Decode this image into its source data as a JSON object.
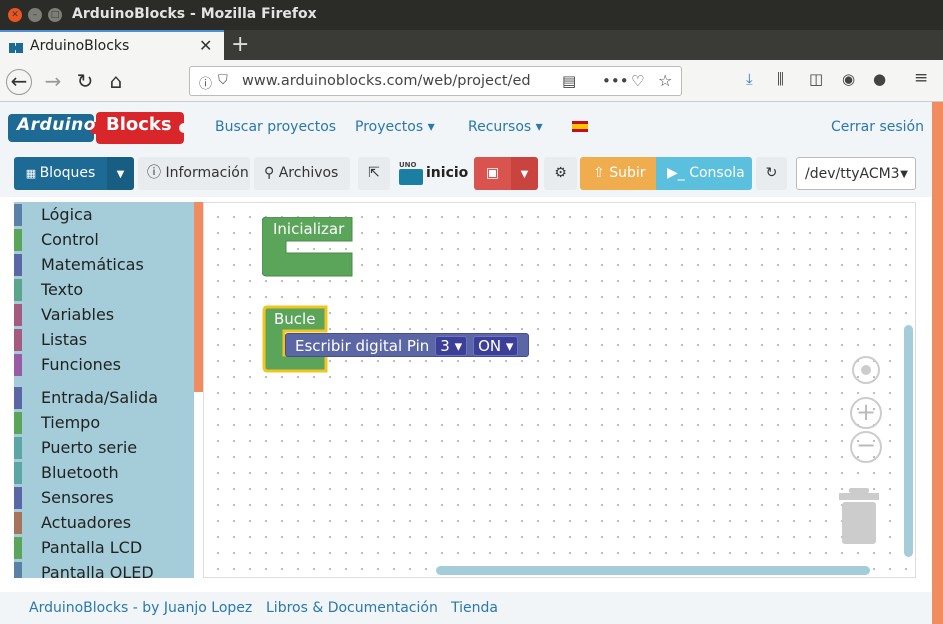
{
  "window": {
    "title": "ArduinoBlocks - Mozilla Firefox"
  },
  "browser": {
    "tab_title": "ArduinoBlocks",
    "url": "www.arduinoblocks.com/web/project/ed"
  },
  "header": {
    "logo_left": "Arduino",
    "logo_right": "Blocks",
    "nav": [
      "Buscar proyectos",
      "Proyectos ▾",
      "Recursos ▾"
    ],
    "logout": "Cerrar sesión"
  },
  "toolbar": {
    "bloques": "Bloques",
    "informacion": "Información",
    "archivos": "Archivos",
    "board_label": "UNO",
    "project_name": "inicio",
    "subir": "Subir",
    "consola": "Consola",
    "port": "/dev/ttyACM3"
  },
  "sidebar": {
    "categories": [
      {
        "label": "Lógica",
        "color": "#5b80a5"
      },
      {
        "label": "Control",
        "color": "#5ba55b"
      },
      {
        "label": "Matemáticas",
        "color": "#5b67a5"
      },
      {
        "label": "Texto",
        "color": "#5ba58c"
      },
      {
        "label": "Variables",
        "color": "#a55b80"
      },
      {
        "label": "Listas",
        "color": "#a55b80"
      },
      {
        "label": "Funciones",
        "color": "#995ba5"
      },
      {
        "label": "Entrada/Salida",
        "color": "#5b67a5"
      },
      {
        "label": "Tiempo",
        "color": "#5ba55b"
      },
      {
        "label": "Puerto serie",
        "color": "#5ba5a5"
      },
      {
        "label": "Bluetooth",
        "color": "#5ba5a5"
      },
      {
        "label": "Sensores",
        "color": "#5b67a5"
      },
      {
        "label": "Actuadores",
        "color": "#a5745b"
      },
      {
        "label": "Pantalla LCD",
        "color": "#5ba55b"
      },
      {
        "label": "Pantalla OLED",
        "color": "#5b80a5"
      }
    ]
  },
  "workspace": {
    "init_block": "Inicializar",
    "loop_block": "Bucle",
    "write_block": {
      "label": "Escribir digital Pin",
      "pin": "3 ▾",
      "state": "ON ▾"
    }
  },
  "footer": {
    "links": [
      "ArduinoBlocks - by Juanjo Lopez",
      "Libros & Documentación",
      "Tienda"
    ]
  },
  "colors": {
    "primary": "#1d6b95",
    "save": "#d9534f",
    "upload": "#f0ad4e",
    "console": "#5bc0de",
    "block_green": "#5ba55b",
    "block_blue": "#5b67a5",
    "accent": "#f08c60"
  }
}
